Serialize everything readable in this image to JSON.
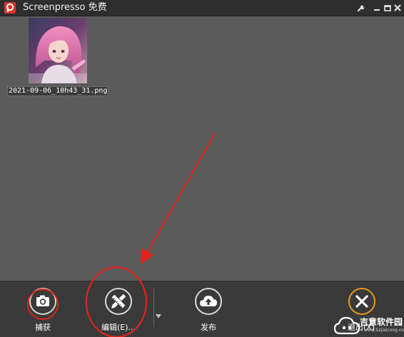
{
  "window": {
    "title": "Screenpresso 免费",
    "logo_icon": "screenpresso-logo",
    "controls": [
      "wrench-icon",
      "minimize-icon",
      "restore-icon",
      "close-icon"
    ]
  },
  "content": {
    "items": [
      {
        "filename": "2021-09-06_10h43_31.png",
        "image": "anime-portrait-pink-hair"
      }
    ]
  },
  "toolbar": {
    "capture_label": "捕获",
    "edit_label": "编辑(E)...",
    "publish_label": "发布",
    "exit_label": "退出(X)"
  },
  "watermark": {
    "text": "吉意软件园",
    "url": "www.52jiaicong.com"
  },
  "colors": {
    "accent_red": "#e0241b",
    "exit_orange": "#e39a1a",
    "toolbar_bg": "#3a3a3a",
    "content_bg": "#5b5b5b"
  }
}
